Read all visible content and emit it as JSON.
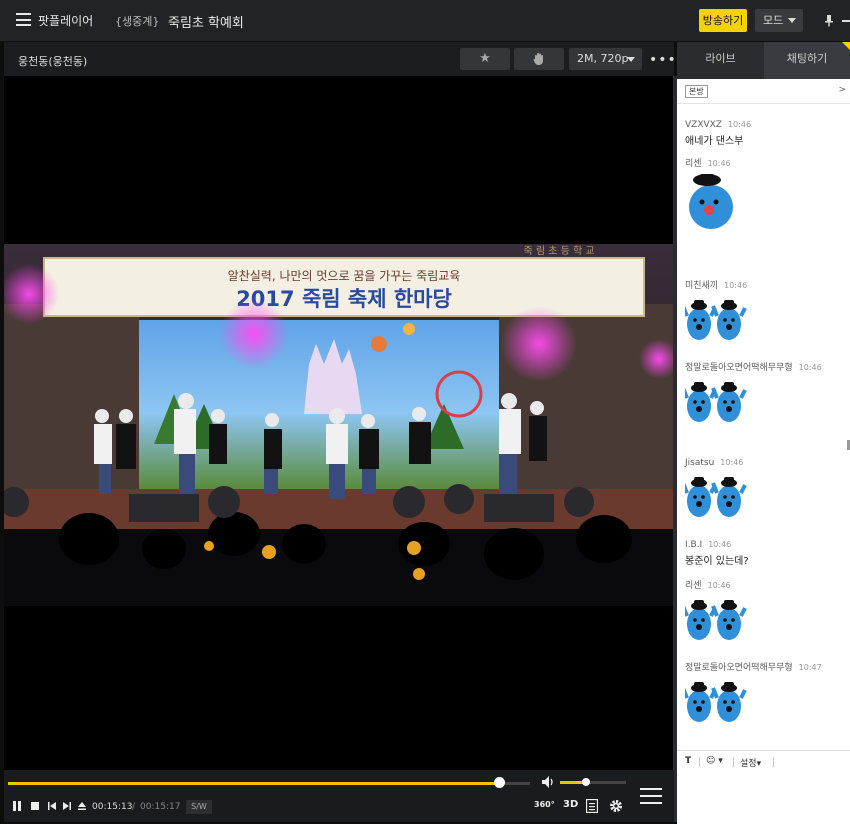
{
  "topbar": {
    "app_title": "팟플레이어",
    "live_tag": "{생중계}",
    "broadcast_title": "죽림초 학예회",
    "broadcast_label": "방송하기",
    "mode_label": "모드"
  },
  "player": {
    "channel_name": "웅천동(웅천동)",
    "quality_label": "2M, 720p",
    "banner_line1": "알찬실력, 나만의 멋으로 꿈을 가꾸는 죽림교육",
    "banner_line2": "2017 죽림 축제 한마당",
    "school_sign": "죽 림 초 등 학 교"
  },
  "controls": {
    "time_current": "00:15:13",
    "time_separator": "/",
    "time_total": "00:15:17",
    "sw_label": "S/W",
    "label_360": "360°",
    "label_3d": "3D",
    "progress_fraction": 0.94,
    "volume_fraction": 0.4
  },
  "chat": {
    "tabs": [
      "라이브",
      "채팅하기"
    ],
    "room_label": "본방",
    "head_arrow": ">",
    "messages": [
      {
        "nick": "VZXVXZ",
        "time": "10:46",
        "text": "애네가 댄스부"
      },
      {
        "nick": "리센",
        "time": "10:46",
        "text": ""
      },
      {
        "nick": "미친새끼",
        "time": "10:46",
        "text": ""
      },
      {
        "nick": "정말로돌아오면어떡해무무형",
        "time": "10:46",
        "text": ""
      },
      {
        "nick": "Jisatsu",
        "time": "10:46",
        "text": ""
      },
      {
        "nick": "I.B.I",
        "time": "10:46",
        "text": "봉준이 있는데?"
      },
      {
        "nick": "리센",
        "time": "10:46",
        "text": ""
      },
      {
        "nick": "정말로돌아오면어떡해무무형",
        "time": "10:47",
        "text": ""
      }
    ],
    "tools": {
      "text_style": "T",
      "emoji": "☺",
      "settings": "설정"
    }
  },
  "colors": {
    "accent": "#f5d300",
    "topbar_bg": "#222326",
    "emote_blue": "#2f8fd8"
  }
}
